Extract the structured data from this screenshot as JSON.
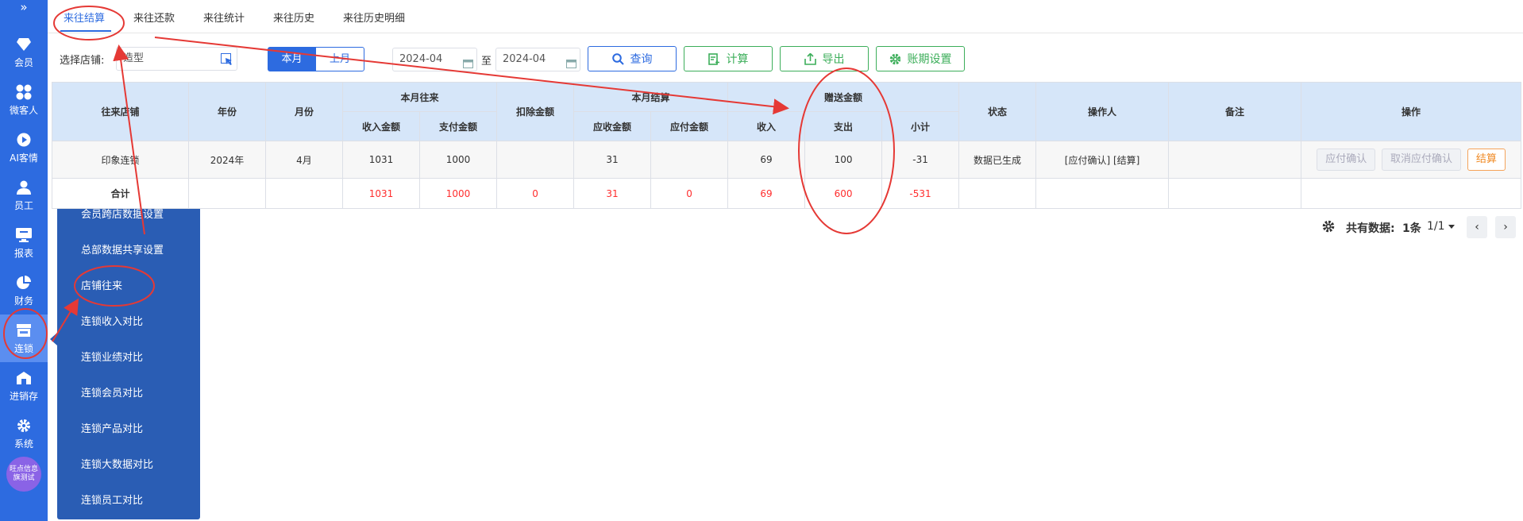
{
  "sidebar": {
    "top_glyph": "»",
    "items": [
      {
        "label": "会员",
        "icon": "diamond-icon"
      },
      {
        "label": "微客人",
        "icon": "apps-icon"
      },
      {
        "label": "AI客情",
        "icon": "play-circle-icon"
      },
      {
        "label": "员工",
        "icon": "user-icon"
      },
      {
        "label": "报表",
        "icon": "monitor-icon"
      },
      {
        "label": "财务",
        "icon": "pie-chart-icon"
      },
      {
        "label": "连锁",
        "icon": "store-icon"
      },
      {
        "label": "进销存",
        "icon": "warehouse-icon"
      },
      {
        "label": "系统",
        "icon": "gear-icon"
      }
    ],
    "avatar_text": "旺点信息\n旗测试"
  },
  "flyout": {
    "items": [
      "会员跨店数据设置",
      "总部数据共享设置",
      "店铺往来",
      "连锁收入对比",
      "连锁业绩对比",
      "连锁会员对比",
      "连锁产品对比",
      "连锁大数据对比",
      "连锁员工对比"
    ]
  },
  "tabs": [
    "来往结算",
    "来往还款",
    "来往统计",
    "来往历史",
    "来往历史明细"
  ],
  "toolbar": {
    "store_label": "选择店铺:",
    "store_value": "造型",
    "this_month": "本月",
    "last_month": "上月",
    "date_from": "2024-04",
    "date_sep": "至",
    "date_to": "2024-04",
    "query": "查询",
    "calculate": "计算",
    "export": "导出",
    "period_settings": "账期设置"
  },
  "table": {
    "headers": {
      "store": "往来店铺",
      "year": "年份",
      "month": "月份",
      "month_exchange": "本月往来",
      "income_amount": "收入金额",
      "pay_amount": "支付金额",
      "deduct": "扣除金额",
      "month_settle": "本月结算",
      "receivable": "应收金额",
      "payable": "应付金额",
      "gift_amount": "赠送金额",
      "gift_income": "收入",
      "gift_expense": "支出",
      "subtotal": "小计",
      "status": "状态",
      "operator": "操作人",
      "remark": "备注",
      "action": "操作"
    },
    "row": {
      "store": "印象连锁",
      "year": "2024年",
      "month": "4月",
      "income_amount": "1031",
      "pay_amount": "1000",
      "deduct": "",
      "receivable": "31",
      "payable": "",
      "gift_income": "69",
      "gift_expense": "100",
      "subtotal": "-31",
      "status": "数据已生成",
      "operator": "[应付确认] [结算]",
      "remark": "",
      "btn_confirm": "应付确认",
      "btn_cancel": "取消应付确认",
      "btn_settle": "结算"
    },
    "total": {
      "label": "合计",
      "income_amount": "1031",
      "pay_amount": "1000",
      "deduct": "0",
      "receivable": "31",
      "payable": "0",
      "gift_income": "69",
      "gift_expense": "600",
      "subtotal": "-531"
    }
  },
  "footer": {
    "total_label": "共有数据:",
    "total_count": "1条",
    "page": "1/1"
  },
  "colors": {
    "brand": "#2d6be0",
    "flyout": "#2a5db4",
    "header_bg": "#d6e6f9",
    "annotation": "#e53935",
    "negative": "#ff2d2d"
  }
}
